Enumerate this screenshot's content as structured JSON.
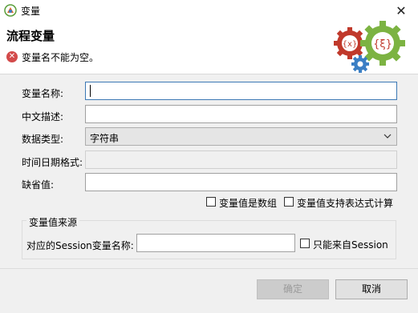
{
  "window": {
    "title": "变量",
    "close_glyph": "✕"
  },
  "header": {
    "title": "流程变量",
    "error_message": "变量名不能为空。",
    "error_glyph": "✕",
    "graphic_texts": [
      "{x}",
      "{ξ}"
    ]
  },
  "form": {
    "name_label": "变量名称:",
    "name_value": "",
    "desc_label": "中文描述:",
    "desc_value": "",
    "type_label": "数据类型:",
    "type_value": "字符串",
    "datetime_label": "时间日期格式:",
    "datetime_value": "",
    "default_label": "缺省值:",
    "default_value": "",
    "is_array_label": "变量值是数组",
    "expression_label": "变量值支持表达式计算"
  },
  "source_group": {
    "title": "变量值来源",
    "session_label": "对应的Session变量名称:",
    "session_value": "",
    "only_session_label": "只能来自Session"
  },
  "buttons": {
    "ok": "确定",
    "cancel": "取消"
  }
}
